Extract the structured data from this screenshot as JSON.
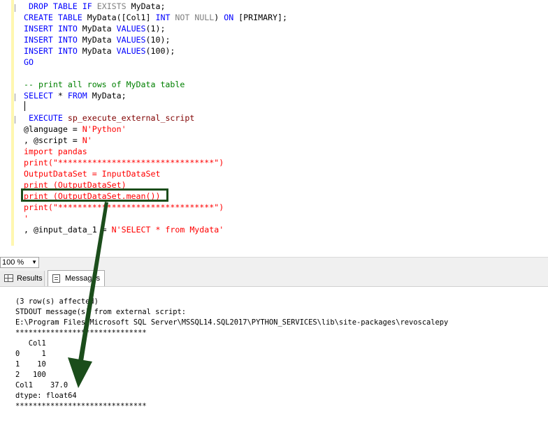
{
  "editor": {
    "lines": [
      {
        "segments": [
          {
            "t": " ",
            "c": "d"
          },
          {
            "t": "DROP",
            "c": "k"
          },
          {
            "t": " ",
            "c": "d"
          },
          {
            "t": "TABLE",
            "c": "k"
          },
          {
            "t": " ",
            "c": "d"
          },
          {
            "t": "IF",
            "c": "k"
          },
          {
            "t": " ",
            "c": "d"
          },
          {
            "t": "EXISTS",
            "c": "g"
          },
          {
            "t": " MyData;",
            "c": "d"
          }
        ]
      },
      {
        "segments": [
          {
            "t": "CREATE",
            "c": "k"
          },
          {
            "t": " ",
            "c": "d"
          },
          {
            "t": "TABLE",
            "c": "k"
          },
          {
            "t": " MyData([Col1] ",
            "c": "d"
          },
          {
            "t": "INT",
            "c": "k"
          },
          {
            "t": " ",
            "c": "d"
          },
          {
            "t": "NOT NULL",
            "c": "g"
          },
          {
            "t": ") ",
            "c": "d"
          },
          {
            "t": "ON",
            "c": "k"
          },
          {
            "t": " [PRIMARY];",
            "c": "d"
          }
        ]
      },
      {
        "segments": [
          {
            "t": "INSERT",
            "c": "k"
          },
          {
            "t": " ",
            "c": "d"
          },
          {
            "t": "INTO",
            "c": "k"
          },
          {
            "t": " MyData ",
            "c": "d"
          },
          {
            "t": "VALUES",
            "c": "k"
          },
          {
            "t": "(1);",
            "c": "d"
          }
        ]
      },
      {
        "segments": [
          {
            "t": "INSERT",
            "c": "k"
          },
          {
            "t": " ",
            "c": "d"
          },
          {
            "t": "INTO",
            "c": "k"
          },
          {
            "t": " MyData ",
            "c": "d"
          },
          {
            "t": "VALUES",
            "c": "k"
          },
          {
            "t": "(10);",
            "c": "d"
          }
        ]
      },
      {
        "segments": [
          {
            "t": "INSERT",
            "c": "k"
          },
          {
            "t": " ",
            "c": "d"
          },
          {
            "t": "INTO",
            "c": "k"
          },
          {
            "t": " MyData ",
            "c": "d"
          },
          {
            "t": "VALUES",
            "c": "k"
          },
          {
            "t": "(100);",
            "c": "d"
          }
        ]
      },
      {
        "segments": [
          {
            "t": "GO",
            "c": "k"
          }
        ]
      },
      {
        "segments": [
          {
            "t": "",
            "c": "d"
          }
        ]
      },
      {
        "segments": [
          {
            "t": "-- print all rows of MyData table",
            "c": "c"
          }
        ]
      },
      {
        "segments": [
          {
            "t": "SELECT",
            "c": "k"
          },
          {
            "t": " * ",
            "c": "d"
          },
          {
            "t": "FROM",
            "c": "k"
          },
          {
            "t": " MyData;",
            "c": "d"
          }
        ]
      },
      {
        "segments": [
          {
            "t": "",
            "c": "d"
          }
        ]
      },
      {
        "segments": [
          {
            "t": " ",
            "c": "d"
          },
          {
            "t": "EXECUTE",
            "c": "k"
          },
          {
            "t": " sp_execute_external_script",
            "c": "f"
          }
        ]
      },
      {
        "segments": [
          {
            "t": "@language = ",
            "c": "d"
          },
          {
            "t": "N'Python'",
            "c": "s"
          }
        ]
      },
      {
        "segments": [
          {
            "t": ", @script = ",
            "c": "d"
          },
          {
            "t": "N'",
            "c": "s"
          }
        ]
      },
      {
        "segments": [
          {
            "t": "import pandas",
            "c": "s"
          }
        ]
      },
      {
        "segments": [
          {
            "t": "print(\"********************************\")",
            "c": "s"
          }
        ]
      },
      {
        "segments": [
          {
            "t": "OutputDataSet = InputDataSet",
            "c": "s"
          }
        ]
      },
      {
        "segments": [
          {
            "t": "print (OutputDataSet)",
            "c": "s"
          }
        ]
      },
      {
        "segments": [
          {
            "t": "print (OutputDataSet.mean())",
            "c": "s"
          }
        ]
      },
      {
        "segments": [
          {
            "t": "print(\"********************************\")",
            "c": "s"
          }
        ]
      },
      {
        "segments": [
          {
            "t": "'",
            "c": "s"
          }
        ]
      },
      {
        "segments": [
          {
            "t": ", @input_data_1 = ",
            "c": "d"
          },
          {
            "t": "N'SELECT * from Mydata'",
            "c": "s"
          }
        ]
      }
    ]
  },
  "zoom": {
    "value": "100 %"
  },
  "tabs": {
    "results": "Results",
    "messages": "Messages"
  },
  "messages": {
    "lines": [
      "(3 row(s) affected)",
      "STDOUT message(s) from external script:",
      "E:\\Program Files\\Microsoft SQL Server\\MSSQL14.SQL2017\\PYTHON_SERVICES\\lib\\site-packages\\revoscalepy",
      "******************************",
      "   Col1",
      "0     1",
      "1    10",
      "2   100",
      "Col1    37.0",
      "dtype: float64",
      "******************************"
    ]
  },
  "colors": {
    "keyword": "#0000ff",
    "string": "#ff0000",
    "comment": "#008000",
    "annotation": "#1b4d1b"
  }
}
